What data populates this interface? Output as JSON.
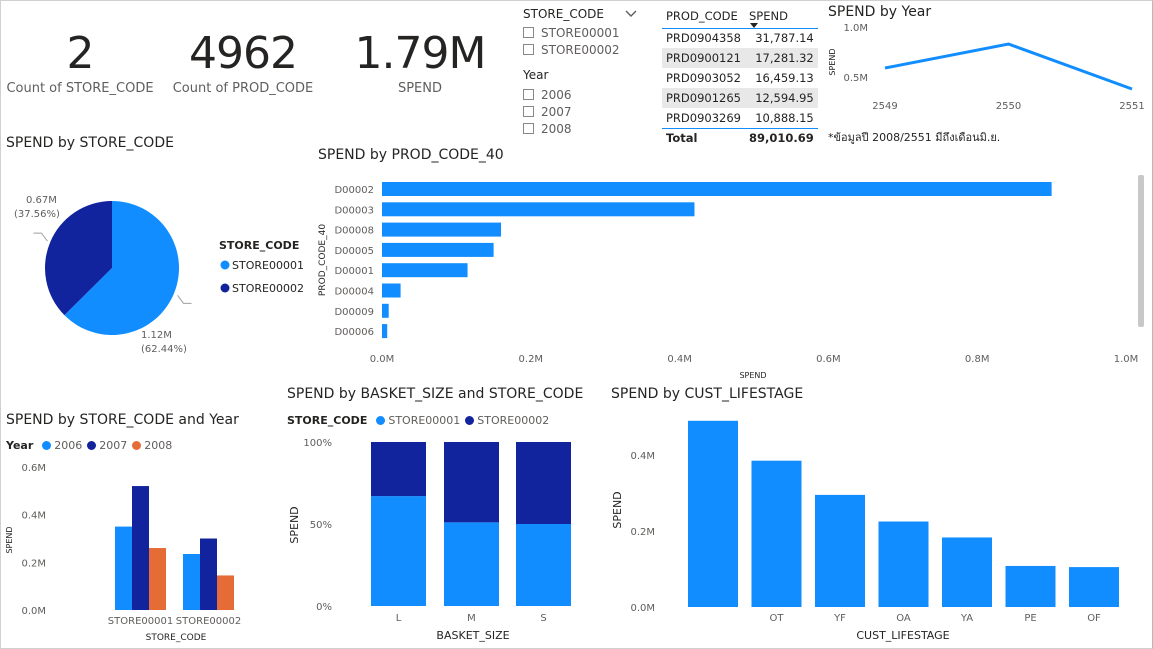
{
  "cards": [
    {
      "value": "2",
      "label": "Count of STORE_CODE"
    },
    {
      "value": "4962",
      "label": "Count of PROD_CODE"
    },
    {
      "value": "1.79M",
      "label": "SPEND"
    }
  ],
  "store_slicer": {
    "title": "STORE_CODE",
    "items": [
      "STORE00001",
      "STORE00002"
    ]
  },
  "year_slicer": {
    "title": "Year",
    "items": [
      "2006",
      "2007",
      "2008"
    ]
  },
  "prod_table": {
    "headers": [
      "PROD_CODE",
      "SPEND"
    ],
    "rows": [
      [
        "PRD0904358",
        "31,787.14"
      ],
      [
        "PRD0900121",
        "17,281.32"
      ],
      [
        "PRD0903052",
        "16,459.13"
      ],
      [
        "PRD0901265",
        "12,594.95"
      ],
      [
        "PRD0903269",
        "10,888.15"
      ]
    ],
    "total_label": "Total",
    "total_value": "89,010.69"
  },
  "note": "*ข้อมูลปี 2008/2551 มีถึงเดือนมิ.ย.",
  "colors": {
    "light_blue": "#118dff",
    "dark_blue": "#12239e",
    "orange": "#e66c37"
  },
  "chart_data": [
    {
      "id": "year_line",
      "type": "line",
      "title": "SPEND by Year",
      "ylabel": "SPEND",
      "x": [
        "2549",
        "2550",
        "2551"
      ],
      "values": [
        0.59,
        0.83,
        0.38
      ],
      "ytick_labels": [
        "0.5M",
        "1.0M"
      ],
      "yticks": [
        0.5,
        1.0
      ],
      "ylim": [
        0.35,
        1.05
      ]
    },
    {
      "id": "store_pie",
      "type": "pie",
      "title": "SPEND by STORE_CODE",
      "legend_title": "STORE_CODE",
      "categories": [
        "STORE00001",
        "STORE00002"
      ],
      "values": [
        1.12,
        0.67
      ],
      "value_labels": [
        "1.12M",
        "0.67M"
      ],
      "pct_labels": [
        "(62.44%)",
        "(37.56%)"
      ]
    },
    {
      "id": "prod_bar",
      "type": "bar",
      "orientation": "horizontal",
      "title": "SPEND by PROD_CODE_40",
      "xlabel": "SPEND",
      "ylabel": "PROD_CODE_40",
      "categories": [
        "D00002",
        "D00003",
        "D00008",
        "D00005",
        "D00001",
        "D00004",
        "D00009",
        "D00006"
      ],
      "values": [
        0.9,
        0.42,
        0.16,
        0.15,
        0.115,
        0.025,
        0.009,
        0.007
      ],
      "xtick_labels": [
        "0.0M",
        "0.2M",
        "0.4M",
        "0.6M",
        "0.8M",
        "1.0M"
      ],
      "xticks": [
        0,
        0.2,
        0.4,
        0.6,
        0.8,
        1.0
      ],
      "xlim": [
        0,
        1.0
      ]
    },
    {
      "id": "store_year_bar",
      "type": "bar",
      "title": "SPEND by STORE_CODE and Year",
      "legend_title": "Year",
      "xlabel": "STORE_CODE",
      "ylabel": "SPEND",
      "categories": [
        "STORE00001",
        "STORE00002"
      ],
      "series": [
        {
          "name": "2006",
          "values": [
            0.35,
            0.235
          ]
        },
        {
          "name": "2007",
          "values": [
            0.52,
            0.3
          ]
        },
        {
          "name": "2008",
          "values": [
            0.26,
            0.145
          ]
        }
      ],
      "ytick_labels": [
        "0.0M",
        "0.2M",
        "0.4M",
        "0.6M"
      ],
      "yticks": [
        0,
        0.2,
        0.4,
        0.6
      ],
      "ylim": [
        0,
        0.6
      ]
    },
    {
      "id": "basket_bar",
      "type": "bar",
      "stacked": "100%",
      "title": "SPEND by BASKET_SIZE and STORE_CODE",
      "legend_title": "STORE_CODE",
      "xlabel": "BASKET_SIZE",
      "ylabel": "SPEND",
      "categories": [
        "L",
        "M",
        "S"
      ],
      "series": [
        {
          "name": "STORE00001",
          "values": [
            0.67,
            0.51,
            0.5
          ]
        },
        {
          "name": "STORE00002",
          "values": [
            0.33,
            0.49,
            0.5
          ]
        }
      ],
      "ytick_labels": [
        "0%",
        "50%",
        "100%"
      ],
      "yticks": [
        0,
        0.5,
        1.0
      ],
      "ylim": [
        0,
        1.0
      ]
    },
    {
      "id": "lifestage_bar",
      "type": "bar",
      "title": "SPEND by CUST_LIFESTAGE",
      "xlabel": "CUST_LIFESTAGE",
      "ylabel": "SPEND",
      "categories": [
        "",
        "OT",
        "YF",
        "OA",
        "YA",
        "PE",
        "OF"
      ],
      "values": [
        0.49,
        0.385,
        0.295,
        0.225,
        0.183,
        0.108,
        0.105
      ],
      "ytick_labels": [
        "0.0M",
        "0.2M",
        "0.4M"
      ],
      "yticks": [
        0,
        0.2,
        0.4
      ],
      "ylim": [
        0,
        0.5
      ]
    }
  ]
}
